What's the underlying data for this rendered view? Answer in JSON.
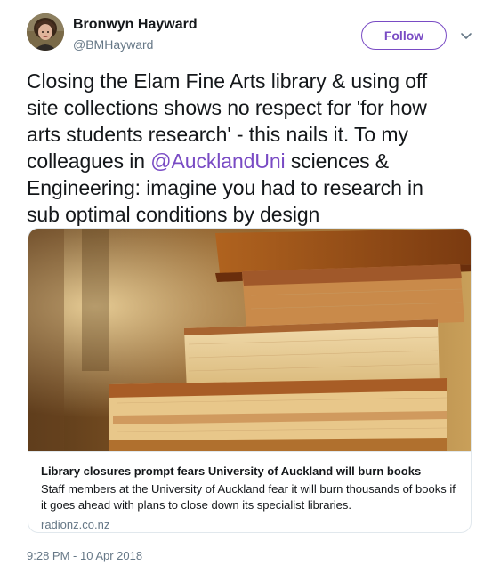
{
  "author": {
    "name": "Bronwyn Hayward",
    "handle": "@BMHayward"
  },
  "follow_button": {
    "label": "Follow"
  },
  "tweet": {
    "line1": "Closing the Elam Fine Arts library & using off",
    "line2": "site collections shows no respect for 'for how",
    "line3": "arts students research' -  this nails it. To my",
    "line4_before": "colleagues in ",
    "mention": "@AucklandUni",
    "line4_after": " sciences &",
    "line5": "Engineering: imagine you had to research in",
    "line6": "sub optimal conditions by design"
  },
  "card": {
    "title": "Library closures prompt fears University of Auckland will burn books",
    "description": "Staff members at the University of Auckland fear it will burn thousands of books if it goes ahead with plans to close down its specialist libraries.",
    "domain": "radionz.co.nz"
  },
  "timestamp": "9:28 PM - 10 Apr 2018",
  "colors": {
    "accent": "#794bc4",
    "text": "#14171a",
    "secondary": "#657786",
    "border": "#e1e8ed"
  },
  "icons": {
    "avatar": "user-avatar-photo",
    "caret": "chevron-down-icon"
  }
}
